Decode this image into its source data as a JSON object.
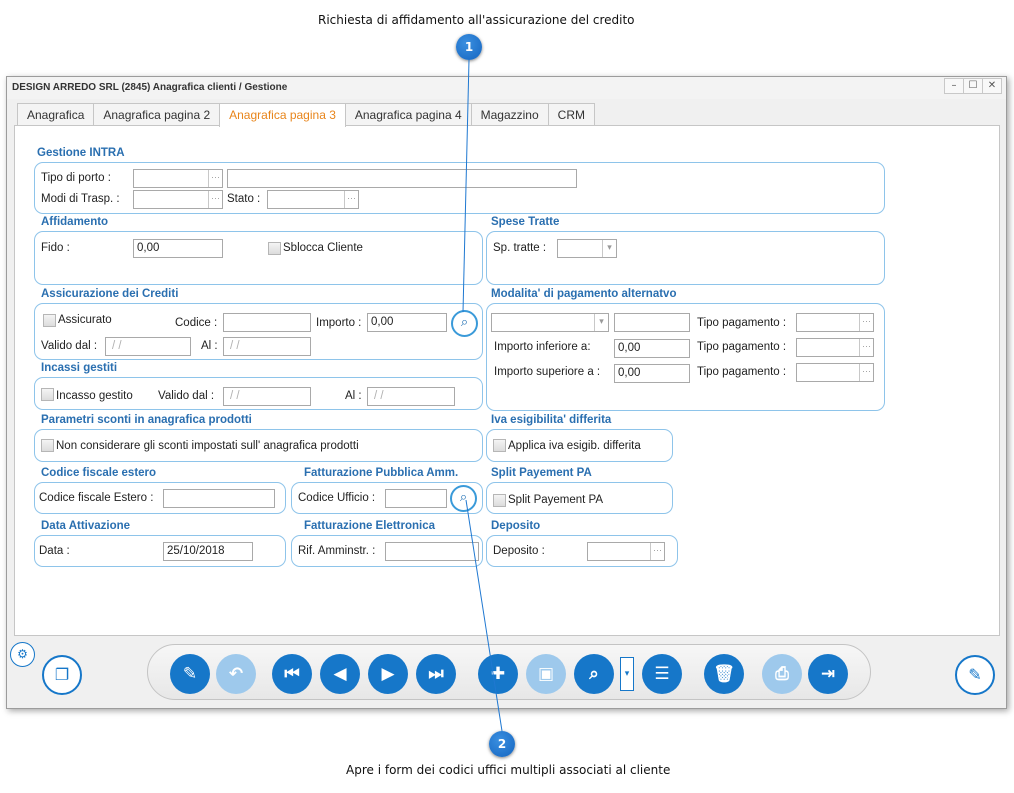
{
  "callouts": [
    {
      "number": "1",
      "text": "Richiesta di affidamento all'assicurazione del credito"
    },
    {
      "number": "2",
      "text": "Apre i  form dei codici uffici multipli associati al cliente"
    }
  ],
  "window": {
    "title": "DESIGN ARREDO SRL (2845) Anagrafica clienti / Gestione",
    "controls": [
      "–",
      "☐",
      "✕"
    ]
  },
  "tabs": [
    {
      "label": "Anagrafica"
    },
    {
      "label": "Anagrafica pagina 2"
    },
    {
      "label": "Anagrafica pagina 3",
      "active": true
    },
    {
      "label": "Anagrafica pagina 4"
    },
    {
      "label": "Magazzino"
    },
    {
      "label": "CRM"
    }
  ],
  "intra": {
    "title": "Gestione INTRA",
    "tipo_porto_label": "Tipo di porto :",
    "modi_trasp_label": "Modi di Trasp. :",
    "stato_label": "Stato :"
  },
  "affidamento": {
    "title": "Affidamento",
    "fido_label": "Fido :",
    "fido_value": "0,00",
    "sblocca_label": "Sblocca Cliente"
  },
  "spese_tratte": {
    "title": "Spese Tratte",
    "sp_label": "Sp. tratte :"
  },
  "assicurazione": {
    "title": "Assicurazione dei Crediti",
    "assicurato_label": "Assicurato",
    "codice_label": "Codice :",
    "importo_label": "Importo :",
    "importo_value": "0,00",
    "valido_label": "Valido dal :",
    "valido_value": "/ /",
    "al_label": "Al :",
    "al_value": "/ /"
  },
  "modalita": {
    "title": "Modalita' di pagamento alternatvo",
    "tipo_pagamento_label": "Tipo pagamento :",
    "importo_inferiore_label": "Importo inferiore a:",
    "importo_inferiore_value": "0,00",
    "importo_superiore_label": "Importo superiore a :",
    "importo_superiore_value": "0,00"
  },
  "incassi": {
    "title": "Incassi gestiti",
    "incasso_label": "Incasso gestito",
    "valido_label": "Valido dal :",
    "valido_value": "/ /",
    "al_label": "Al :",
    "al_value": "/ /"
  },
  "sconti": {
    "title": "Parametri sconti in anagrafica prodotti",
    "check_label": "Non considerare gli sconti impostati sull' anagrafica prodotti"
  },
  "iva": {
    "title": "Iva esigibilita' differita",
    "check_label": "Applica iva esigib. differita"
  },
  "cf_estero": {
    "title": "Codice fiscale estero",
    "label": "Codice fiscale Estero :"
  },
  "fatt_pa": {
    "title": "Fatturazione Pubblica Amm.",
    "label": "Codice Ufficio :"
  },
  "split": {
    "title": "Split Payement PA",
    "check_label": "Split Payement PA"
  },
  "data_attivazione": {
    "title": "Data Attivazione",
    "label": "Data :",
    "value": "25/10/2018"
  },
  "fatt_elettronica": {
    "title": "Fatturazione Elettronica",
    "label": "Rif. Amminstr. :"
  },
  "deposito": {
    "title": "Deposito",
    "label": "Deposito :"
  },
  "icons": {
    "edit": "✎",
    "undo": "↶",
    "first": "⏮",
    "prev": "◀",
    "next": "▶",
    "last": "⏭",
    "new": "✚",
    "save": "▣",
    "search": "⌕",
    "dropdown": "▾",
    "list": "☰",
    "delete": "🗑",
    "print": "⎙",
    "exit": "⇥",
    "copy": "❐",
    "gear": "⚙",
    "ellipsis": "···",
    "combo": "▾"
  }
}
